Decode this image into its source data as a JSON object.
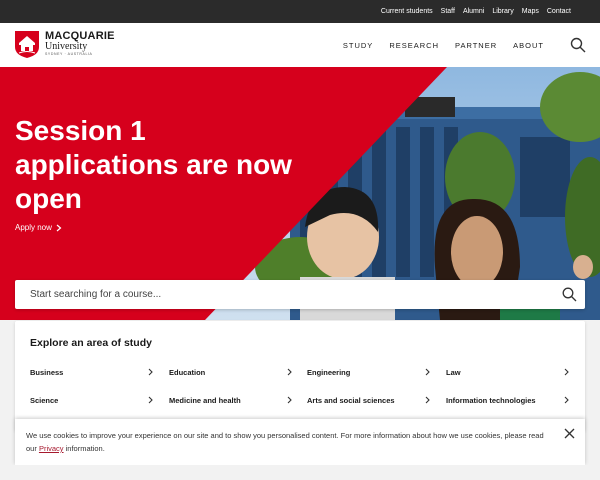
{
  "topbar": {
    "links": [
      "Current students",
      "Staff",
      "Alumni",
      "Library",
      "Maps",
      "Contact"
    ]
  },
  "header": {
    "logo_name": "MACQUARIE",
    "logo_sub": "University",
    "logo_location": "SYDNEY · AUSTRALIA",
    "nav": [
      "STUDY",
      "RESEARCH",
      "PARTNER",
      "ABOUT"
    ],
    "search_icon": "search-icon"
  },
  "hero": {
    "headline": "Session 1 applications are now open",
    "cta": "Apply now",
    "accent": "#d6001c"
  },
  "search": {
    "placeholder": "Start searching for a course..."
  },
  "explore": {
    "title": "Explore an area of study",
    "areas": [
      "Business",
      "Education",
      "Engineering",
      "Law",
      "Science",
      "Medicine and health",
      "Arts and social sciences",
      "Information technologies"
    ]
  },
  "cookie": {
    "text_before": "We use cookies to improve your experience on our site and to show you personalised content. For more information about how we use cookies, please read our ",
    "link": "Privacy",
    "text_after": " information."
  }
}
